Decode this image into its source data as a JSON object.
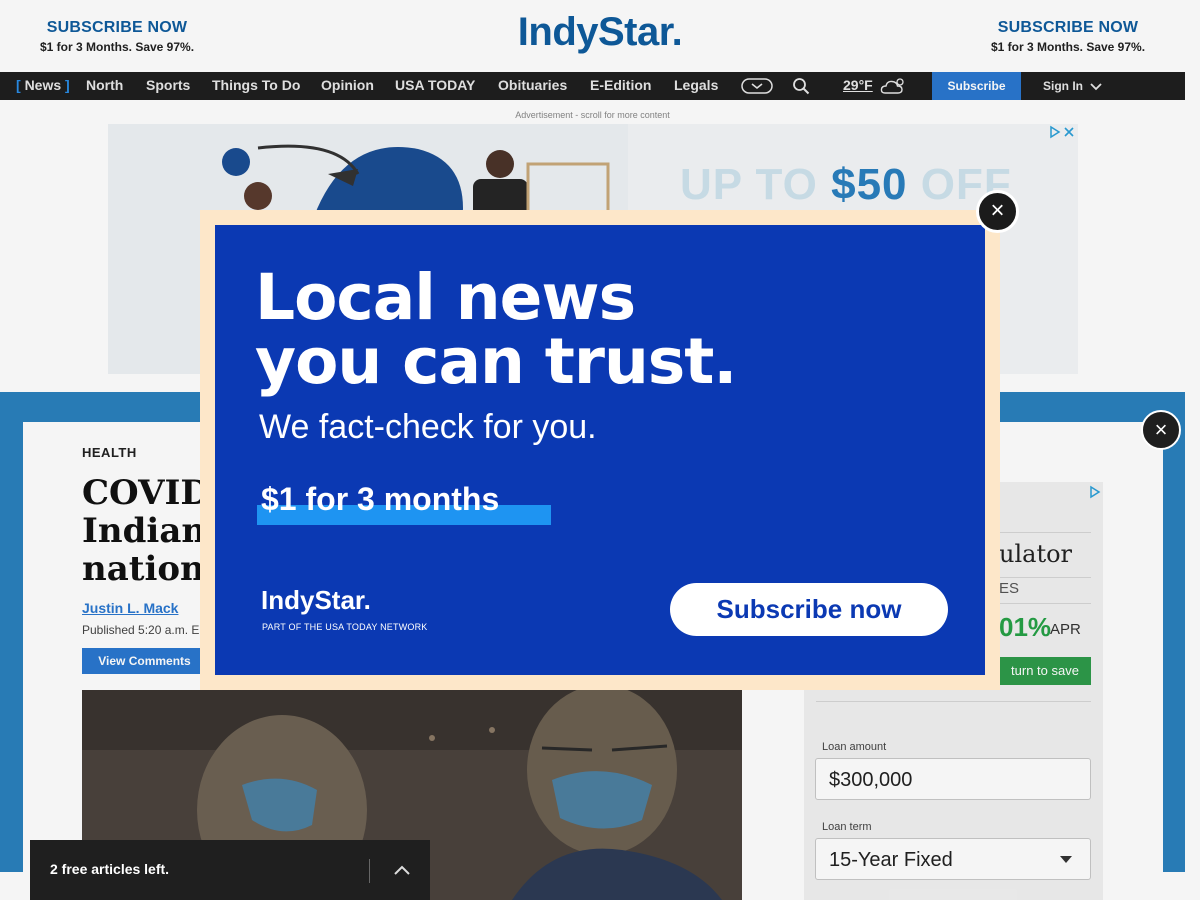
{
  "header": {
    "promo_left": {
      "headline": "SUBSCRIBE NOW",
      "sub": "$1 for 3 Months. Save 97%."
    },
    "promo_right": {
      "headline": "SUBSCRIBE NOW",
      "sub": "$1 for 3 Months. Save 97%."
    },
    "logo": "IndyStar."
  },
  "nav": {
    "active": "News",
    "items": [
      "North",
      "Sports",
      "Things To Do",
      "Opinion",
      "USA TODAY",
      "Obituaries",
      "E-Edition",
      "Legals"
    ],
    "weather": "29°F",
    "subscribe": "Subscribe",
    "signin": "Sign In"
  },
  "ad": {
    "label": "Advertisement - scroll for more content",
    "headline_pre": "UP TO ",
    "headline_amount": "$50",
    "headline_post": " OFF"
  },
  "article": {
    "section": "HEALTH",
    "headline_lines": [
      "COVID",
      "Indiana",
      "nation"
    ],
    "byline": "Justin L. Mack",
    "published": "Published 5:20 a.m. E",
    "view_comments": "View Comments"
  },
  "calculator": {
    "title": "ulator",
    "subtitle": "ES",
    "rate": "01%",
    "apr": "APR",
    "cta": "turn to save",
    "loan_amount_label": "Loan amount",
    "loan_amount": "$300,000",
    "loan_term_label": "Loan term",
    "loan_term": "15-Year Fixed"
  },
  "modal": {
    "headline_1": "Local news",
    "headline_2": "you can trust.",
    "subtitle": "We fact-check for you.",
    "offer": "$1 for 3 months",
    "logo": "IndyStar.",
    "network": "PART OF THE USA TODAY NETWORK",
    "cta": "Subscribe now",
    "close": "×"
  },
  "overlay": {
    "close": "×"
  },
  "meter": {
    "text": "2 free articles left."
  },
  "colors": {
    "brand": "#0f5c9e",
    "modal_blue": "#0b39b3",
    "modal_frame": "#fde7c9",
    "offer_highlight": "#1e94f2",
    "subscribe_blue": "#2a77d0"
  }
}
